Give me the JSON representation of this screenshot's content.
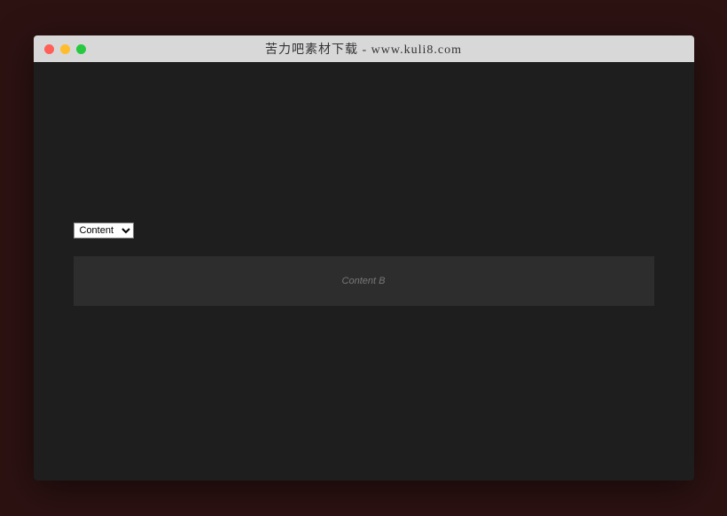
{
  "titlebar": {
    "title": "苦力吧素材下载 - www.kuli8.com"
  },
  "content": {
    "select": {
      "selected_label": "Content B",
      "selected_value": "B"
    },
    "panel": {
      "label": "Content B"
    }
  }
}
